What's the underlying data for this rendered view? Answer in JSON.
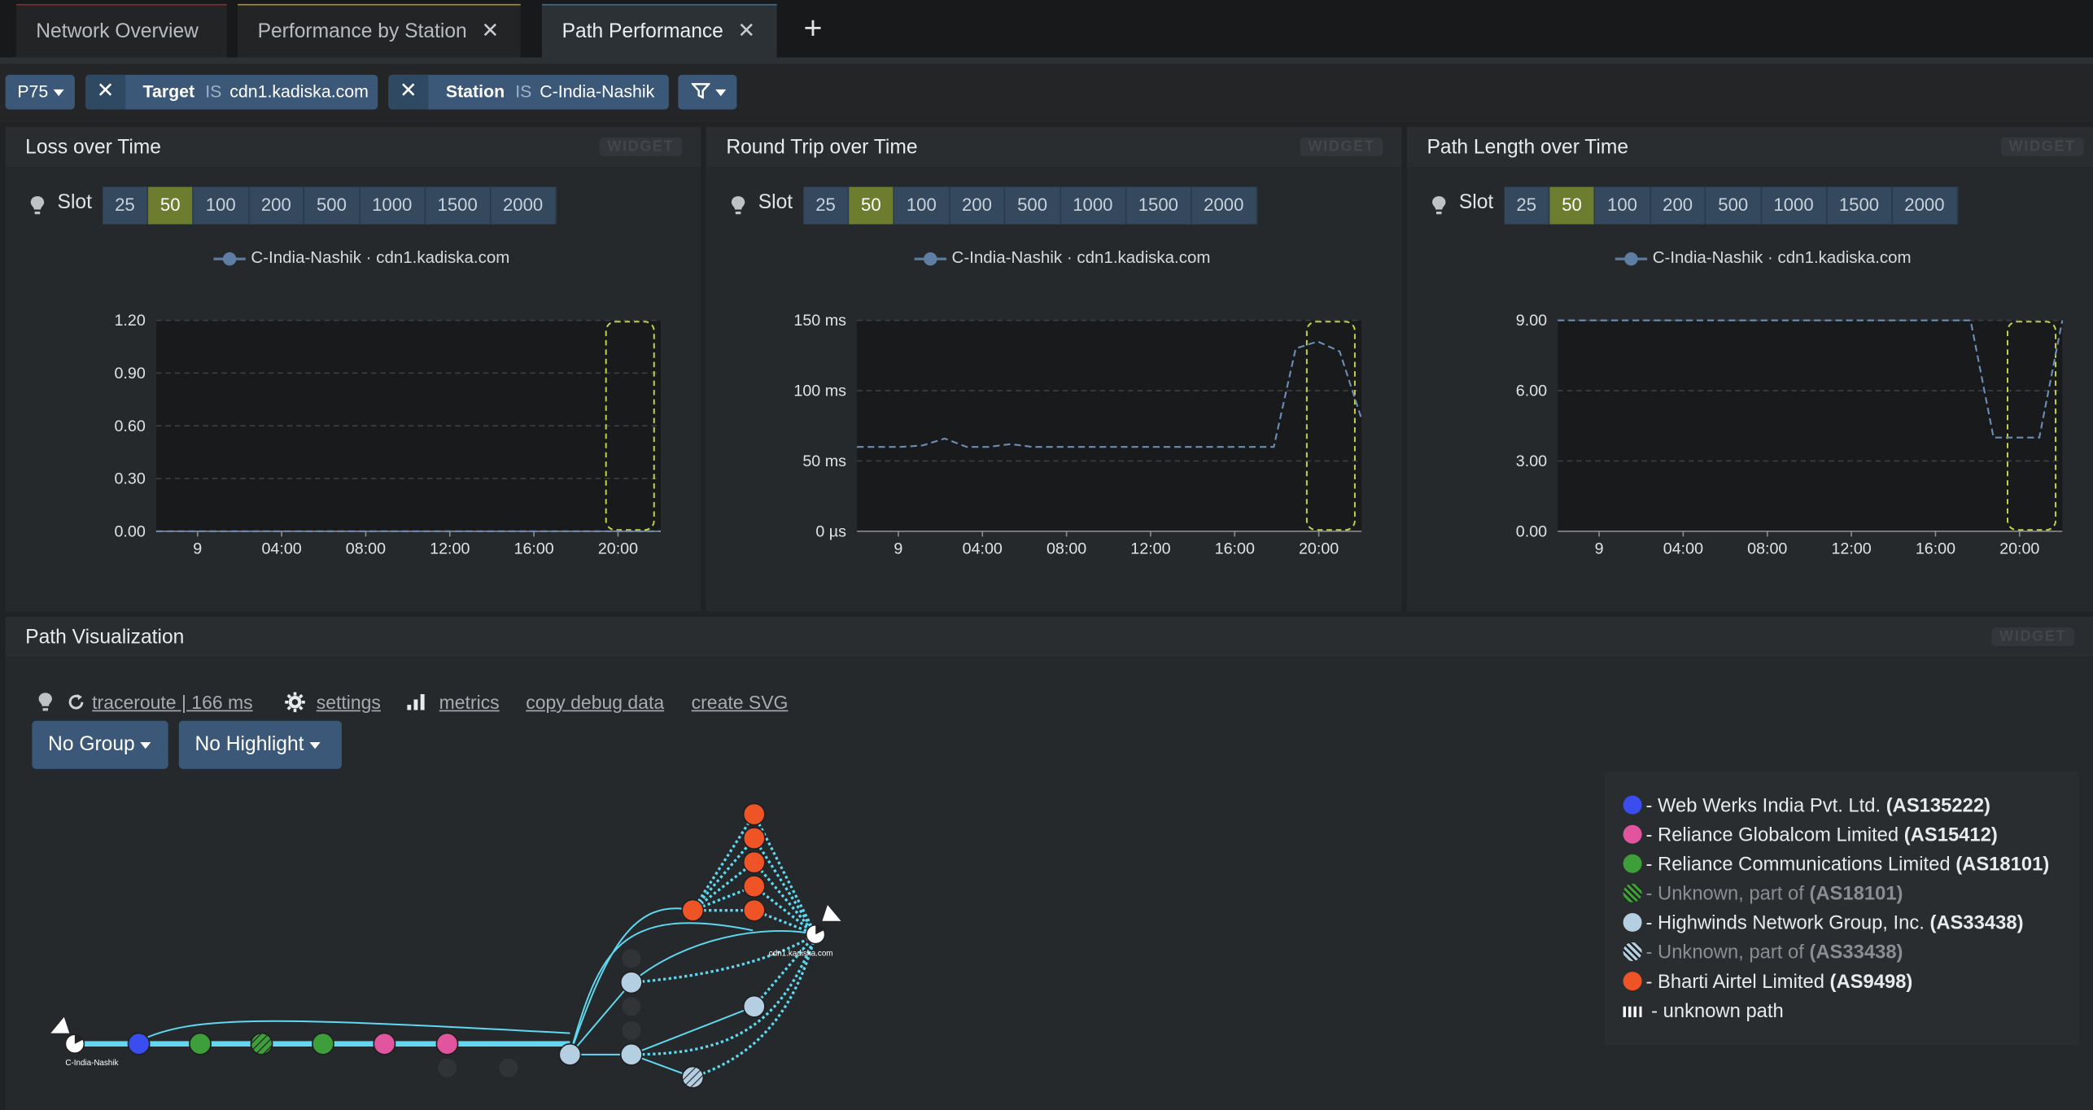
{
  "tabs": [
    {
      "label": "Network Overview"
    },
    {
      "label": "Performance by Station"
    },
    {
      "label": "Path Performance"
    }
  ],
  "filters": {
    "percentile": "P75",
    "target_field": "Target",
    "target_op": "IS",
    "target_value": "cdn1.kadiska.com",
    "station_field": "Station",
    "station_op": "IS",
    "station_value": "C-India-Nashik"
  },
  "widget_badge": "WIDGET",
  "slot": {
    "label": "Slot",
    "options": [
      "25",
      "50",
      "100",
      "200",
      "500",
      "1000",
      "1500",
      "2000"
    ],
    "selected": "50"
  },
  "series_name": "C-India-Nashik · cdn1.kadiska.com",
  "x_ticks": [
    "9",
    "04:00",
    "08:00",
    "12:00",
    "16:00",
    "20:00"
  ],
  "charts": [
    {
      "title": "Loss over Time",
      "y_ticks": [
        "0.00",
        "0.30",
        "0.60",
        "0.90",
        "1.20"
      ]
    },
    {
      "title": "Round Trip over Time",
      "y_ticks": [
        "0 µs",
        "50 ms",
        "100 ms",
        "150 ms"
      ]
    },
    {
      "title": "Path Length over Time",
      "y_ticks": [
        "0.00",
        "3.00",
        "6.00",
        "9.00"
      ]
    }
  ],
  "chart_data": [
    {
      "type": "line",
      "title": "Loss over Time",
      "x": [
        "9",
        "04:00",
        "08:00",
        "12:00",
        "16:00",
        "20:00"
      ],
      "ylim": [
        0,
        1.2
      ],
      "series": [
        {
          "name": "C-India-Nashik · cdn1.kadiska.com",
          "values": [
            0,
            0,
            0,
            0,
            0,
            0,
            0
          ]
        }
      ],
      "highlight": "20:00"
    },
    {
      "type": "line",
      "title": "Round Trip over Time",
      "x": [
        "9",
        "04:00",
        "08:00",
        "12:00",
        "16:00",
        "20:00"
      ],
      "ylim": [
        0,
        150
      ],
      "yunit": "ms",
      "series": [
        {
          "name": "C-India-Nashik · cdn1.kadiska.com",
          "values": [
            60,
            60,
            60,
            61,
            66,
            60,
            60,
            62,
            60,
            60,
            60,
            60,
            60,
            60,
            60,
            60,
            60,
            60,
            60,
            60,
            130,
            135,
            128,
            80
          ]
        }
      ],
      "highlight": "20:00"
    },
    {
      "type": "line",
      "title": "Path Length over Time",
      "x": [
        "9",
        "04:00",
        "08:00",
        "12:00",
        "16:00",
        "20:00"
      ],
      "ylim": [
        0,
        9
      ],
      "series": [
        {
          "name": "C-India-Nashik · cdn1.kadiska.com",
          "values": [
            9,
            9,
            9,
            9,
            9,
            9,
            9,
            9,
            9,
            9,
            9,
            9,
            9,
            9,
            9,
            9,
            9,
            9,
            9,
            4,
            4,
            4,
            9
          ]
        }
      ],
      "highlight": "20:00"
    }
  ],
  "path_viz": {
    "title": "Path Visualization",
    "traceroute": "traceroute | 166 ms",
    "settings": "settings",
    "metrics": "metrics",
    "copy_debug": "copy debug data",
    "create_svg": "create SVG",
    "group_btn": "No Group",
    "highlight_btn": "No Highlight",
    "source_label": "C-India-Nashik",
    "target_label": "cdn1.kadiska.com",
    "legend": [
      {
        "name": "Web Werks India Pvt. Ltd.",
        "asn": "(AS135222)",
        "color": "#3a4ef0",
        "dim": false,
        "hatched": false
      },
      {
        "name": "Reliance Globalcom Limited",
        "asn": "(AS15412)",
        "color": "#e0559e",
        "dim": false,
        "hatched": false
      },
      {
        "name": "Reliance Communications Limited",
        "asn": "(AS18101)",
        "color": "#3d9e3a",
        "dim": false,
        "hatched": false
      },
      {
        "name": "Unknown, part of",
        "asn": "(AS18101)",
        "color": "#3d9e3a",
        "dim": true,
        "hatched": true
      },
      {
        "name": "Highwinds Network Group, Inc.",
        "asn": "(AS33438)",
        "color": "#b5cfe2",
        "dim": false,
        "hatched": false
      },
      {
        "name": "Unknown, part of",
        "asn": "(AS33438)",
        "color": "#b5cfe2",
        "dim": true,
        "hatched": true
      },
      {
        "name": "Bharti Airtel Limited",
        "asn": "(AS9498)",
        "color": "#ef5427",
        "dim": false,
        "hatched": false
      }
    ],
    "unknown_path": "- unknown path"
  }
}
